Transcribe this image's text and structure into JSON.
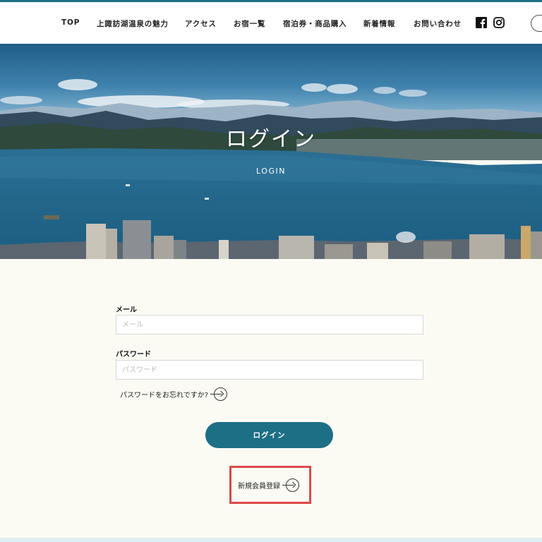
{
  "colors": {
    "accent": "#1b6f83",
    "button": "#1c6f84",
    "highlight": "#e04848",
    "page_background": "#fbfbf4"
  },
  "header": {
    "nav": [
      {
        "label": "TOP"
      },
      {
        "label": "上諏訪湖温泉の魅力"
      },
      {
        "label": "アクセス"
      },
      {
        "label": "お宿一覧"
      },
      {
        "label": "宿泊券・商品購入"
      },
      {
        "label": "新着情報"
      },
      {
        "label": "お問い合わせ"
      }
    ],
    "social_icons": [
      "facebook-icon",
      "instagram-icon"
    ]
  },
  "hero": {
    "title": "ログイン",
    "subtitle": "LOGIN"
  },
  "form": {
    "email": {
      "label": "メール",
      "placeholder": "メール",
      "value": ""
    },
    "password": {
      "label": "パスワード",
      "placeholder": "パスワード",
      "value": ""
    },
    "forgot_link": "パスワードをお忘れですか?",
    "login_button": "ログイン",
    "register_link": "新規会員登録"
  }
}
